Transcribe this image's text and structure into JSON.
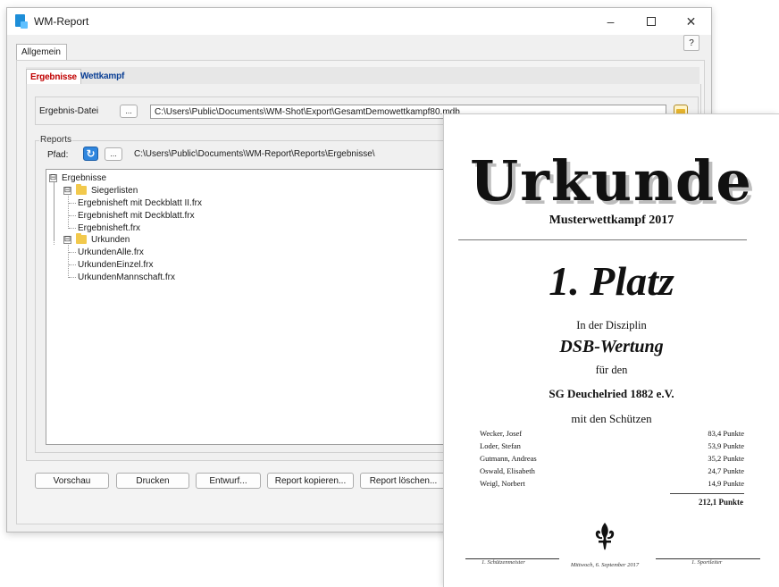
{
  "window": {
    "title": "WM-Report",
    "minimize": "–",
    "maximize": "□",
    "close": "✕",
    "help": "?"
  },
  "outer_tab": {
    "label": "Allgemein"
  },
  "inner_tabs": {
    "active": "Ergebnisse",
    "other": "Wettkampf"
  },
  "result_file": {
    "label": "Ergebnis-Datei",
    "browse": "...",
    "path": "C:\\Users\\Public\\Documents\\WM-Shot\\Export\\GesamtDemowettkampf80.mdb"
  },
  "reports": {
    "group_title": "Reports",
    "path_label": "Pfad:",
    "refresh": "↻",
    "browse": "...",
    "path": "C:\\Users\\Public\\Documents\\WM-Report\\Reports\\Ergebnisse\\"
  },
  "tree": {
    "root": "Ergebnisse",
    "collapse": "⊟",
    "folder1": "Siegerlisten",
    "folder1_items": [
      "Ergebnisheft mit Deckblatt II.frx",
      "Ergebnisheft mit Deckblatt.frx",
      "Ergebnisheft.frx"
    ],
    "folder2": "Urkunden",
    "folder2_items": [
      "UrkundenAlle.frx",
      "UrkundenEinzel.frx",
      "UrkundenMannschaft.frx"
    ]
  },
  "buttons": {
    "preview": "Vorschau",
    "print": "Drucken",
    "draft": "Entwurf...",
    "copy": "Report kopieren...",
    "delete": "Report löschen..."
  },
  "certificate": {
    "title": "Urkunde",
    "event": "Musterwettkampf 2017",
    "place": "1. Platz",
    "discipline_intro": "In der Disziplin",
    "discipline": "DSB-Wertung",
    "for": "für den",
    "club": "SG Deuchelried 1882 e.V.",
    "with": "mit den Schützen",
    "shooters": [
      {
        "name": "Wecker, Josef",
        "points": "83,4 Punkte"
      },
      {
        "name": "Loder, Stefan",
        "points": "53,9 Punkte"
      },
      {
        "name": "Gutmann, Andreas",
        "points": "35,2 Punkte"
      },
      {
        "name": "Oswald, Elisabeth",
        "points": "24,7 Punkte"
      },
      {
        "name": "Weigl, Norbert",
        "points": "14,9 Punkte"
      }
    ],
    "total": "212,1 Punkte",
    "sig_left": "1. Schützenmeister",
    "sig_right": "1. Sportleiter",
    "date": "Mittwoch, 6. September 2017"
  },
  "colors": {
    "active_tab_text": "#c00000",
    "other_tab_text": "#0a3f95",
    "refresh_button": "#2f86de"
  }
}
